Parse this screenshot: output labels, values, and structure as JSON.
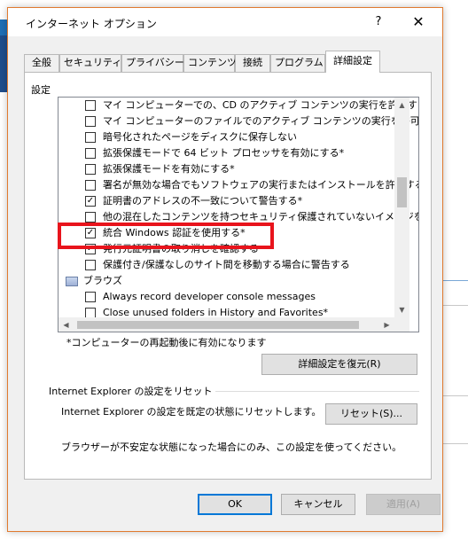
{
  "dialog": {
    "title": "インターネット オプション",
    "help_label": "?",
    "close_label": "✕"
  },
  "tabs": [
    {
      "label": "全般"
    },
    {
      "label": "セキュリティ"
    },
    {
      "label": "プライバシー"
    },
    {
      "label": "コンテンツ"
    },
    {
      "label": "接続"
    },
    {
      "label": "プログラム"
    },
    {
      "label": "詳細設定",
      "active": true
    }
  ],
  "settings_section_label": "設定",
  "settings_list": [
    {
      "label": "マイ コンピューターでの、CD のアクティブ コンテンツの実行を許可する*",
      "checked": false
    },
    {
      "label": "マイ コンピューターのファイルでのアクティブ コンテンツの実行を許可する*",
      "checked": false
    },
    {
      "label": "暗号化されたページをディスクに保存しない",
      "checked": false
    },
    {
      "label": "拡張保護モードで 64 ビット プロセッサを有効にする*",
      "checked": false
    },
    {
      "label": "拡張保護モードを有効にする*",
      "checked": false
    },
    {
      "label": "署名が無効な場合でもソフトウェアの実行またはインストールを許可する",
      "checked": false
    },
    {
      "label": "証明書のアドレスの不一致について警告する*",
      "checked": true
    },
    {
      "label": "他の混在したコンテンツを持つセキュリティ保護されていないイメージをブ",
      "checked": false
    },
    {
      "label": "統合 Windows 認証を使用する*",
      "checked": true
    },
    {
      "label": "発行元証明書の取り消しを確認する",
      "checked": true
    },
    {
      "label": "保護付き/保護なしのサイト間を移動する場合に警告する",
      "checked": false
    }
  ],
  "category": {
    "label": "ブラウズ"
  },
  "browse_list": [
    {
      "label": "Always record developer console messages",
      "checked": false
    },
    {
      "label": "Close unused folders in History and Favorites*",
      "checked": false
    }
  ],
  "check_mark": "✓",
  "scroll_icons": {
    "up": "▲",
    "down": "▼",
    "left": "◀",
    "right": "▶"
  },
  "restart_note": "*コンピューターの再起動後に有効になります",
  "restore_button": "詳細設定を復元(R)",
  "reset_section": {
    "title": "Internet Explorer の設定をリセット",
    "description": "Internet Explorer の設定を既定の状態にリセットします。",
    "button": "リセット(S)...",
    "note": "ブラウザーが不安定な状態になった場合にのみ、この設定を使ってください。"
  },
  "footer": {
    "ok": "OK",
    "cancel": "キャンセル",
    "apply": "適用(A)"
  },
  "colors": {
    "highlight": "#e8141c",
    "accent": "#0078d7",
    "dialog_border": "#e07a2f"
  }
}
